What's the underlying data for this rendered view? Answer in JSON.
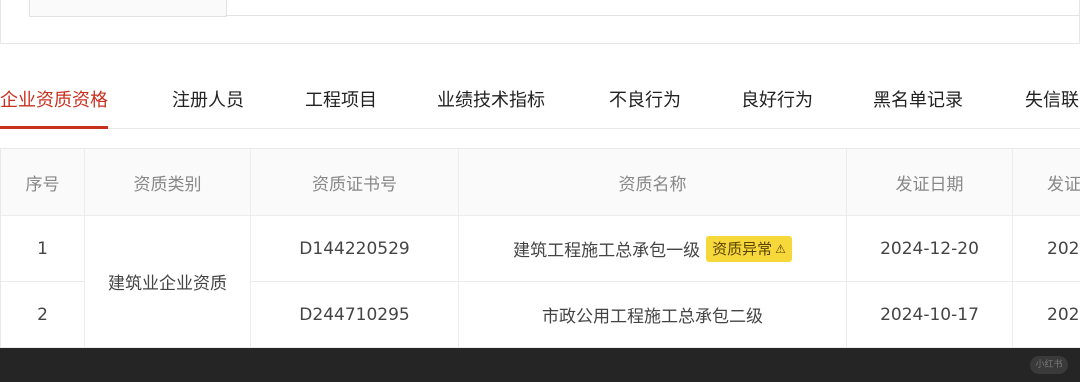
{
  "tabs": [
    {
      "label": "企业资质资格",
      "active": true
    },
    {
      "label": "注册人员"
    },
    {
      "label": "工程项目"
    },
    {
      "label": "业绩技术指标"
    },
    {
      "label": "不良行为"
    },
    {
      "label": "良好行为"
    },
    {
      "label": "黑名单记录"
    },
    {
      "label": "失信联"
    }
  ],
  "table": {
    "headers": [
      "序号",
      "资质类别",
      "资质证书号",
      "资质名称",
      "发证日期",
      "发证"
    ],
    "category": "建筑业企业资质",
    "rows": [
      {
        "index": "1",
        "cert_no": "D144220529",
        "name": "建筑工程施工总承包一级",
        "badge": "资质异常",
        "issue_date": "2024-12-20",
        "issuer": "202"
      },
      {
        "index": "2",
        "cert_no": "D244710295",
        "name": "市政公用工程施工总承包二级",
        "issue_date": "2024-10-17",
        "issuer": "202"
      }
    ]
  },
  "colors": {
    "accent": "#c8301e",
    "badge": "#f7d83a"
  },
  "watermark": "小红书"
}
